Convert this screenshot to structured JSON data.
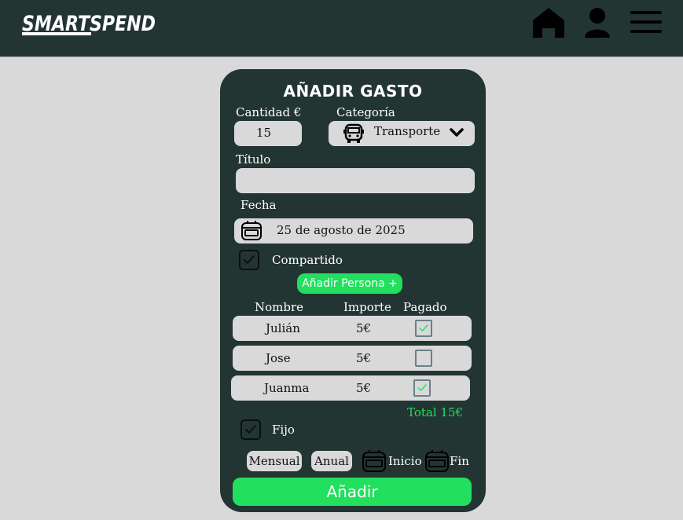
{
  "header": {
    "logo": "SMARTSPEND",
    "icons": [
      "home-icon",
      "user-icon",
      "menu-icon"
    ]
  },
  "form": {
    "title": "AÑADIR GASTO",
    "cantidad_label": "Cantidad €",
    "cantidad_value": "15",
    "categoria_label": "Categoría",
    "categoria_value": "Transporte",
    "titulo_label": "Título",
    "titulo_value": "",
    "fecha_label": "Fecha",
    "fecha_value": "25 de agosto de 2025",
    "compartido_label": "Compartido",
    "compartido_checked": true,
    "add_person_label": "Añadir Persona +",
    "table": {
      "headers": [
        "Nombre",
        "Importe",
        "Pagado"
      ],
      "rows": [
        {
          "name": "Julián",
          "amount": "5€",
          "paid": true
        },
        {
          "name": "Jose",
          "amount": "5€",
          "paid": false
        },
        {
          "name": "Juanma",
          "amount": "5€",
          "paid": true
        }
      ]
    },
    "total_label": "Total 15€",
    "fijo_label": "Fijo",
    "fijo_checked": true,
    "mensual_label": "Mensual",
    "anual_label": "Anual",
    "inicio_label": "Inicio",
    "fin_label": "Fin",
    "submit_label": "Añadir"
  },
  "colors": {
    "dark": "#233533",
    "accent": "#22df5e",
    "field": "#d9d9d9"
  }
}
